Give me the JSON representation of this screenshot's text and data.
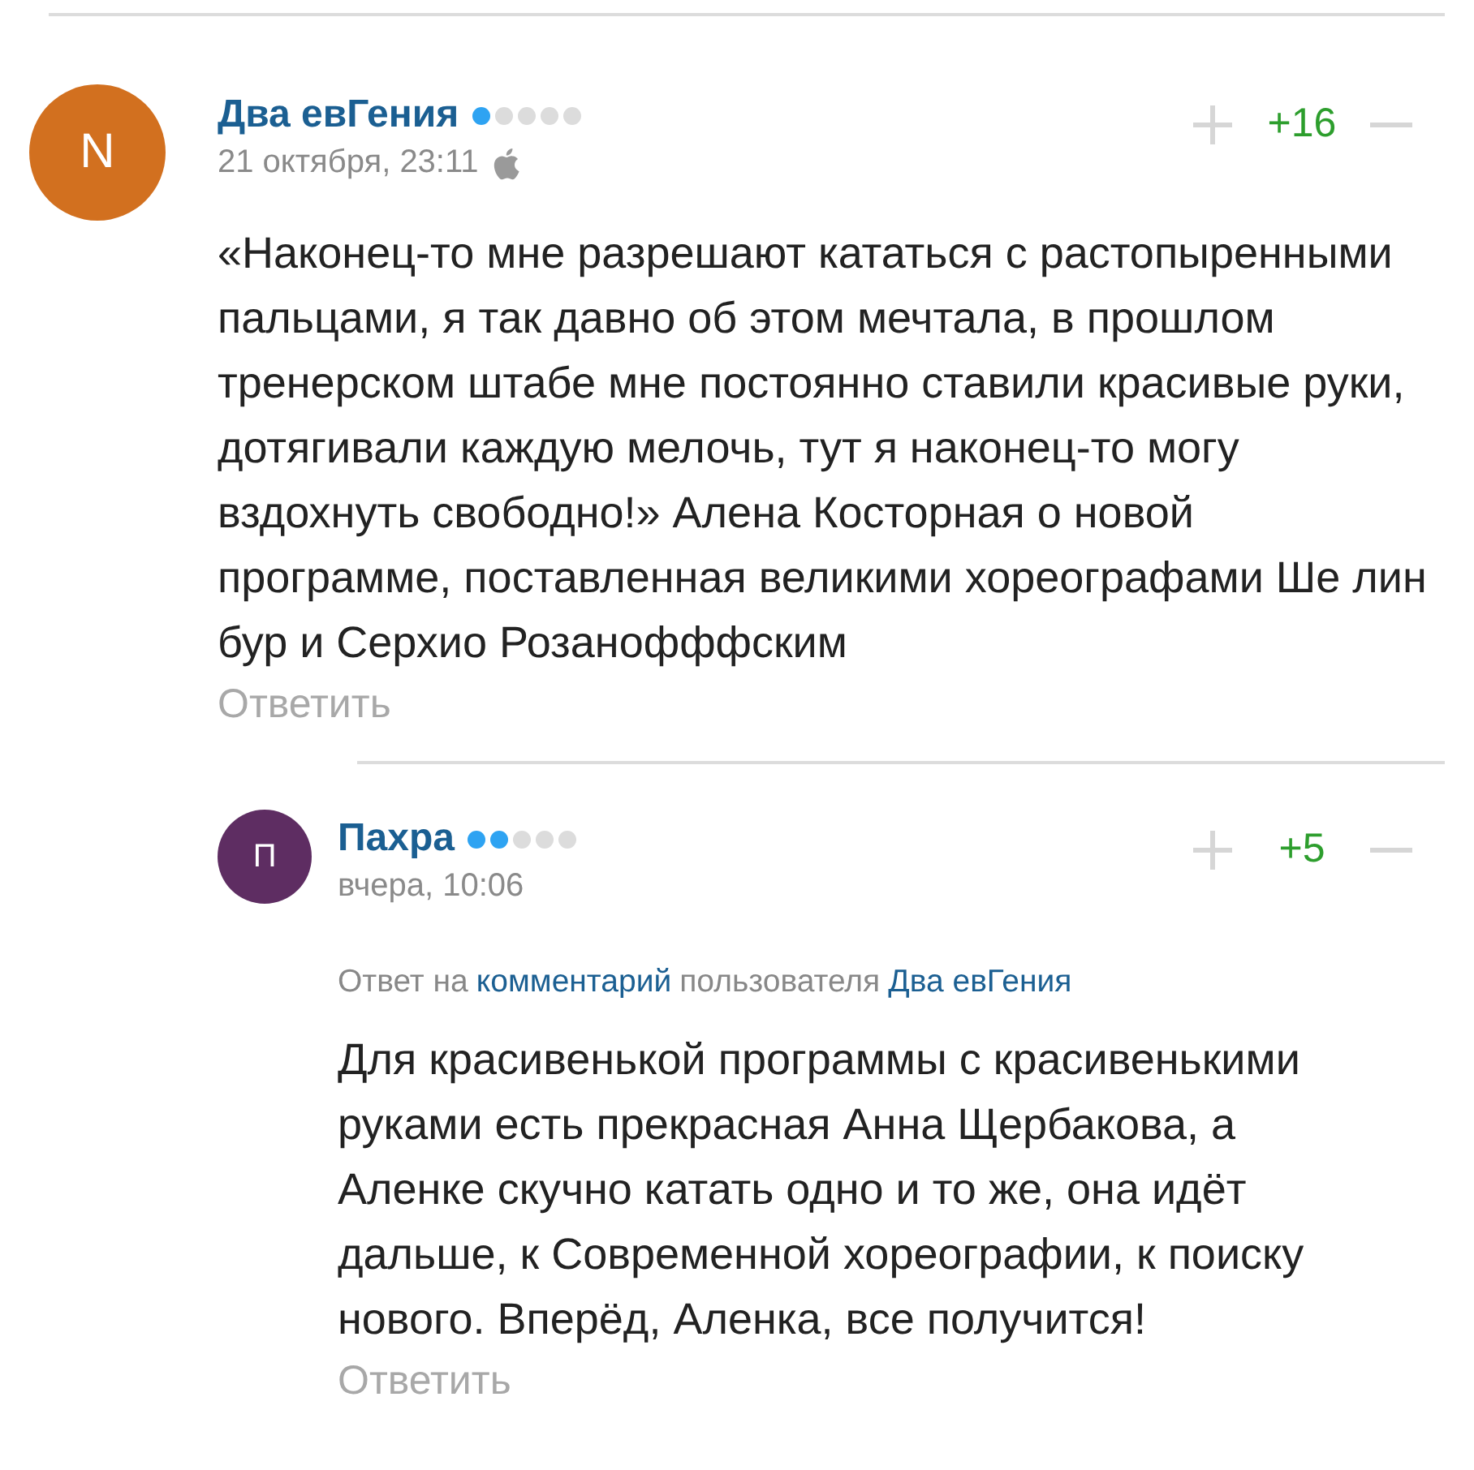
{
  "comments": [
    {
      "author": "Два евГения",
      "avatar": {
        "letter": "N",
        "color": "#d2701f"
      },
      "stars": 1,
      "time": "21 октября, 23:11",
      "device_icon": true,
      "score": "+16",
      "text": "«Наконец-то мне разрешают кататься с растопыренными пальцами, я так давно об этом мечтала, в прошлом тренерском штабе мне постоянно ставили красивые руки, дотягивали каждую мелочь, тут я наконец-то могу вздохнуть свободно!» Алена Косторная о новой программе, поставленная великими хореографами Ше лин бур и Серхио Розанофффским",
      "reply": "Ответить",
      "children": [
        {
          "author": "Пахра",
          "avatar": {
            "letter": "П",
            "color": "#5e2d62"
          },
          "stars": 2,
          "time": "вчера, 10:06",
          "score": "+5",
          "reply_to": [
            {
              "kind": "plain",
              "text": "Ответ на"
            },
            {
              "kind": "link",
              "text": "комментарий"
            },
            {
              "kind": "plain",
              "text": "пользователя"
            },
            {
              "kind": "link",
              "text": "Два евГения"
            }
          ],
          "text": "Для красивенькой программы с красивенькими руками есть прекрасная Анна Щербакова, а Аленке скучно катать одно и то же, она идёт дальше, к Современной хореографии, к поиску нового. Вперёд, Аленка, все получится!",
          "reply": "Ответить"
        }
      ]
    }
  ]
}
